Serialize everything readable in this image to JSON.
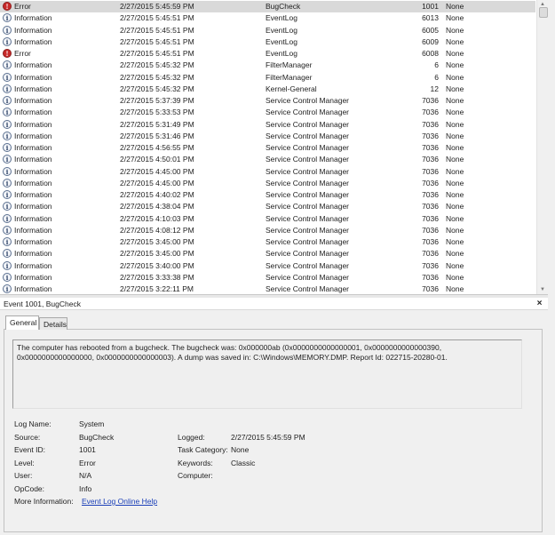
{
  "events": [
    {
      "level": "Error",
      "icon": "error-icon",
      "date": "2/27/2015 5:45:59 PM",
      "source": "BugCheck",
      "id": "1001",
      "task": "None",
      "selected": true
    },
    {
      "level": "Information",
      "icon": "info-icon",
      "date": "2/27/2015 5:45:51 PM",
      "source": "EventLog",
      "id": "6013",
      "task": "None"
    },
    {
      "level": "Information",
      "icon": "info-icon",
      "date": "2/27/2015 5:45:51 PM",
      "source": "EventLog",
      "id": "6005",
      "task": "None"
    },
    {
      "level": "Information",
      "icon": "info-icon",
      "date": "2/27/2015 5:45:51 PM",
      "source": "EventLog",
      "id": "6009",
      "task": "None"
    },
    {
      "level": "Error",
      "icon": "error-icon",
      "date": "2/27/2015 5:45:51 PM",
      "source": "EventLog",
      "id": "6008",
      "task": "None"
    },
    {
      "level": "Information",
      "icon": "info-icon",
      "date": "2/27/2015 5:45:32 PM",
      "source": "FilterManager",
      "id": "6",
      "task": "None"
    },
    {
      "level": "Information",
      "icon": "info-icon",
      "date": "2/27/2015 5:45:32 PM",
      "source": "FilterManager",
      "id": "6",
      "task": "None"
    },
    {
      "level": "Information",
      "icon": "info-icon",
      "date": "2/27/2015 5:45:32 PM",
      "source": "Kernel-General",
      "id": "12",
      "task": "None"
    },
    {
      "level": "Information",
      "icon": "info-icon",
      "date": "2/27/2015 5:37:39 PM",
      "source": "Service Control Manager",
      "id": "7036",
      "task": "None"
    },
    {
      "level": "Information",
      "icon": "info-icon",
      "date": "2/27/2015 5:33:53 PM",
      "source": "Service Control Manager",
      "id": "7036",
      "task": "None"
    },
    {
      "level": "Information",
      "icon": "info-icon",
      "date": "2/27/2015 5:31:49 PM",
      "source": "Service Control Manager",
      "id": "7036",
      "task": "None"
    },
    {
      "level": "Information",
      "icon": "info-icon",
      "date": "2/27/2015 5:31:46 PM",
      "source": "Service Control Manager",
      "id": "7036",
      "task": "None"
    },
    {
      "level": "Information",
      "icon": "info-icon",
      "date": "2/27/2015 4:56:55 PM",
      "source": "Service Control Manager",
      "id": "7036",
      "task": "None"
    },
    {
      "level": "Information",
      "icon": "info-icon",
      "date": "2/27/2015 4:50:01 PM",
      "source": "Service Control Manager",
      "id": "7036",
      "task": "None"
    },
    {
      "level": "Information",
      "icon": "info-icon",
      "date": "2/27/2015 4:45:00 PM",
      "source": "Service Control Manager",
      "id": "7036",
      "task": "None"
    },
    {
      "level": "Information",
      "icon": "info-icon",
      "date": "2/27/2015 4:45:00 PM",
      "source": "Service Control Manager",
      "id": "7036",
      "task": "None"
    },
    {
      "level": "Information",
      "icon": "info-icon",
      "date": "2/27/2015 4:40:02 PM",
      "source": "Service Control Manager",
      "id": "7036",
      "task": "None"
    },
    {
      "level": "Information",
      "icon": "info-icon",
      "date": "2/27/2015 4:38:04 PM",
      "source": "Service Control Manager",
      "id": "7036",
      "task": "None"
    },
    {
      "level": "Information",
      "icon": "info-icon",
      "date": "2/27/2015 4:10:03 PM",
      "source": "Service Control Manager",
      "id": "7036",
      "task": "None"
    },
    {
      "level": "Information",
      "icon": "info-icon",
      "date": "2/27/2015 4:08:12 PM",
      "source": "Service Control Manager",
      "id": "7036",
      "task": "None"
    },
    {
      "level": "Information",
      "icon": "info-icon",
      "date": "2/27/2015 3:45:00 PM",
      "source": "Service Control Manager",
      "id": "7036",
      "task": "None"
    },
    {
      "level": "Information",
      "icon": "info-icon",
      "date": "2/27/2015 3:45:00 PM",
      "source": "Service Control Manager",
      "id": "7036",
      "task": "None"
    },
    {
      "level": "Information",
      "icon": "info-icon",
      "date": "2/27/2015 3:40:00 PM",
      "source": "Service Control Manager",
      "id": "7036",
      "task": "None"
    },
    {
      "level": "Information",
      "icon": "info-icon",
      "date": "2/27/2015 3:33:38 PM",
      "source": "Service Control Manager",
      "id": "7036",
      "task": "None"
    },
    {
      "level": "Information",
      "icon": "info-icon",
      "date": "2/27/2015 3:22:11 PM",
      "source": "Service Control Manager",
      "id": "7036",
      "task": "None"
    }
  ],
  "details": {
    "title": "Event 1001, BugCheck",
    "close": "×",
    "tabs": {
      "general": "General",
      "details": "Details"
    },
    "message": "The computer has rebooted from a bugcheck.  The bugcheck was: 0x000000ab (0x0000000000000001, 0x0000000000000390, 0x0000000000000000, 0x0000000000000003). A dump was saved in: C:\\Windows\\MEMORY.DMP. Report Id: 022715-20280-01.",
    "fields": {
      "log_name_label": "Log Name:",
      "log_name": "System",
      "source_label": "Source:",
      "source": "BugCheck",
      "event_id_label": "Event ID:",
      "event_id": "1001",
      "level_label": "Level:",
      "level": "Error",
      "user_label": "User:",
      "user": "N/A",
      "opcode_label": "OpCode:",
      "opcode": "Info",
      "more_info_label": "More Information:",
      "more_info_link": "Event Log Online Help",
      "logged_label": "Logged:",
      "logged": "2/27/2015 5:45:59 PM",
      "task_category_label": "Task Category:",
      "task_category": "None",
      "keywords_label": "Keywords:",
      "keywords": "Classic",
      "computer_label": "Computer:",
      "computer": ""
    }
  }
}
